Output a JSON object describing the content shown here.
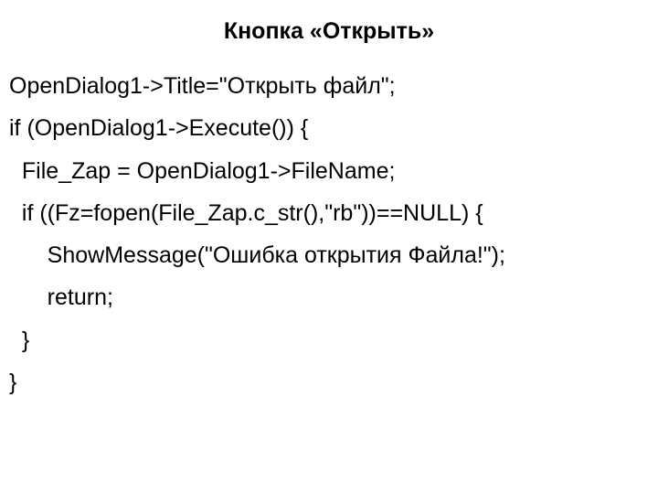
{
  "heading": "Кнопка «Открыть»",
  "code": {
    "l1": "OpenDialog1->Title=\"Открыть файл\";",
    "l2": "if (OpenDialog1->Execute()) {",
    "l3": "  File_Zap = OpenDialog1->FileName;",
    "l4": "  if ((Fz=fopen(File_Zap.c_str(),\"rb\"))==NULL) {",
    "l5": "      ShowMessage(\"Ошибка открытия Файла!\");",
    "l6": "      return;",
    "l7": "  }",
    "l8": "}"
  }
}
